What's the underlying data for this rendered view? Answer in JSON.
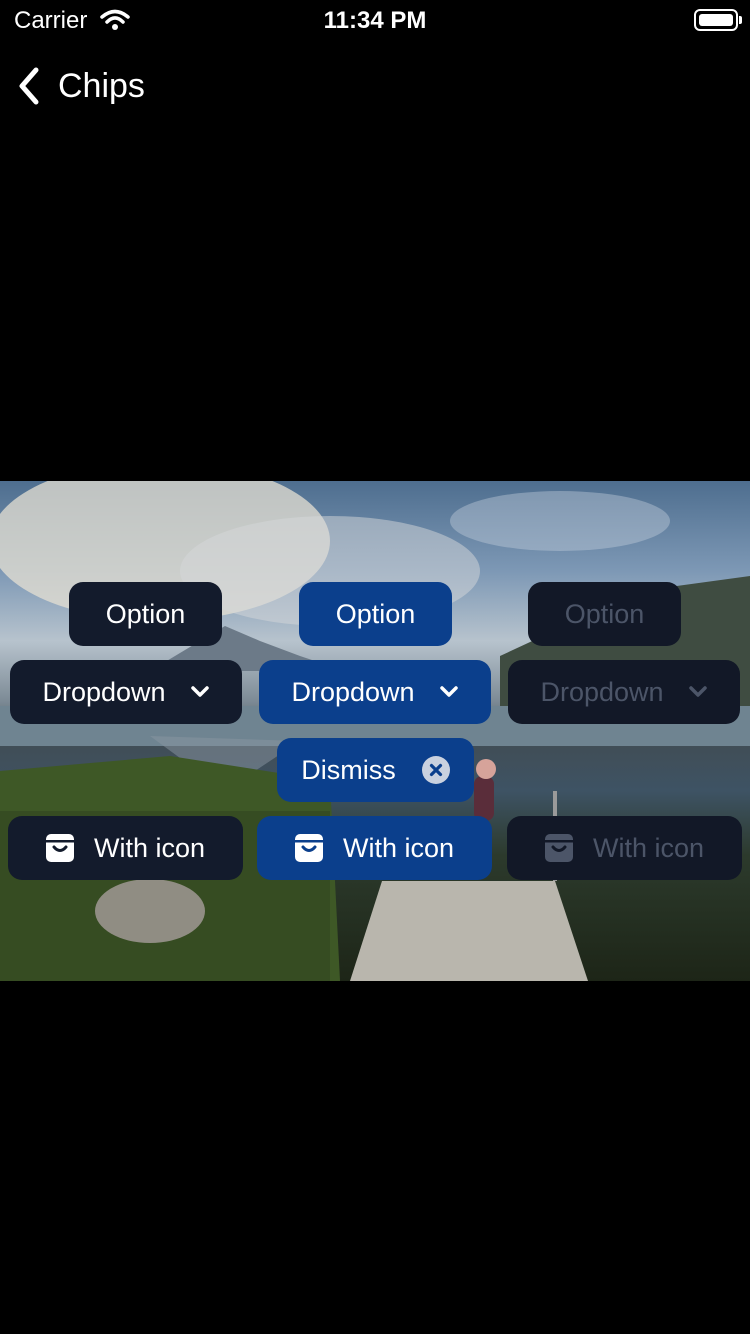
{
  "status_bar": {
    "carrier": "Carrier",
    "time": "11:34 PM"
  },
  "nav": {
    "back_icon": "chevron-left-icon",
    "title": "Chips"
  },
  "chips": {
    "option": {
      "label": "Option"
    },
    "dropdown": {
      "label": "Dropdown",
      "icon": "chevron-down-icon"
    },
    "dismiss": {
      "label": "Dismiss",
      "icon": "close-circle-icon"
    },
    "with_icon": {
      "label": "With icon",
      "icon": "shopping-bag-icon"
    }
  },
  "colors": {
    "dark_chip": "#131b2c",
    "blue_chip": "#0b3f8c",
    "disabled_chip": "#121827",
    "disabled_text": "#4c5568"
  }
}
